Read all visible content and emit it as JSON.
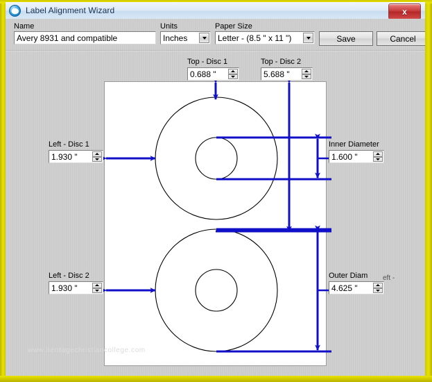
{
  "window": {
    "title": "Label Alignment Wizard",
    "icon": "app-disc-icon",
    "close_label": "x"
  },
  "toolbar": {
    "name": {
      "label": "Name",
      "value": "Avery 8931 and compatible"
    },
    "units": {
      "label": "Units",
      "value": "Inches"
    },
    "paper_size": {
      "label": "Paper Size",
      "value": "Letter - (8.5 \" x 11 \")"
    },
    "save_label": "Save",
    "cancel_label": "Cancel"
  },
  "dimensions": {
    "top_disc_1": {
      "label": "Top - Disc 1",
      "value": "0.688 \""
    },
    "top_disc_2": {
      "label": "Top - Disc 2",
      "value": "5.688 \""
    },
    "left_disc_1": {
      "label": "Left - Disc 1",
      "value": "1.930 \""
    },
    "left_disc_2": {
      "label": "Left - Disc 2",
      "value": "1.930 \""
    },
    "inner_diameter": {
      "label": "Inner Diameter",
      "value": "1.600 \""
    },
    "outer_diameter": {
      "label": "Outer Diam",
      "value": "4.625 \"",
      "artifact": "eft -"
    }
  },
  "canvas": {
    "watermark": "www.heritagechristiancollege.com",
    "arrow_color": "#1010c8",
    "disc_outline_color": "#000000",
    "paper_color": "#ffffff"
  }
}
